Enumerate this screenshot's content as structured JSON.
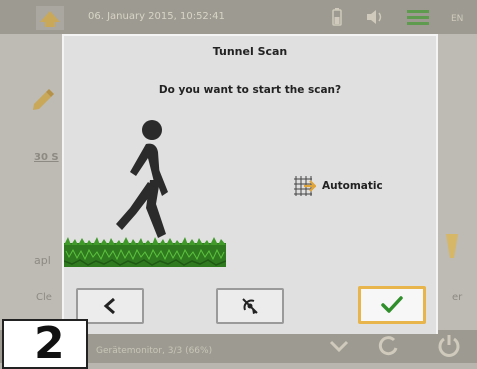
{
  "background": {
    "datetime": "06. January 2015, 10:52:41",
    "label_1": "30 S",
    "label_2": "apl",
    "label_3": "Cle",
    "label_right": "er",
    "bottom_text": "Gerätemonitor, 3/3 (66%)"
  },
  "dialog": {
    "title": "Tunnel Scan",
    "question": "Do you want to start the scan?",
    "mode_label": "Automatic",
    "mode_icon": "grid-sensor-icon",
    "buttons": {
      "back_icon": "chevron-left-icon",
      "ignore_icon": "crossed-out-sensor-icon",
      "confirm_icon": "checkmark-icon"
    }
  },
  "step_badge": {
    "number": "2"
  },
  "colors": {
    "accent": "#e8b44c",
    "confirm_check": "#2f8f2a",
    "grass": "#2f7a1f"
  }
}
